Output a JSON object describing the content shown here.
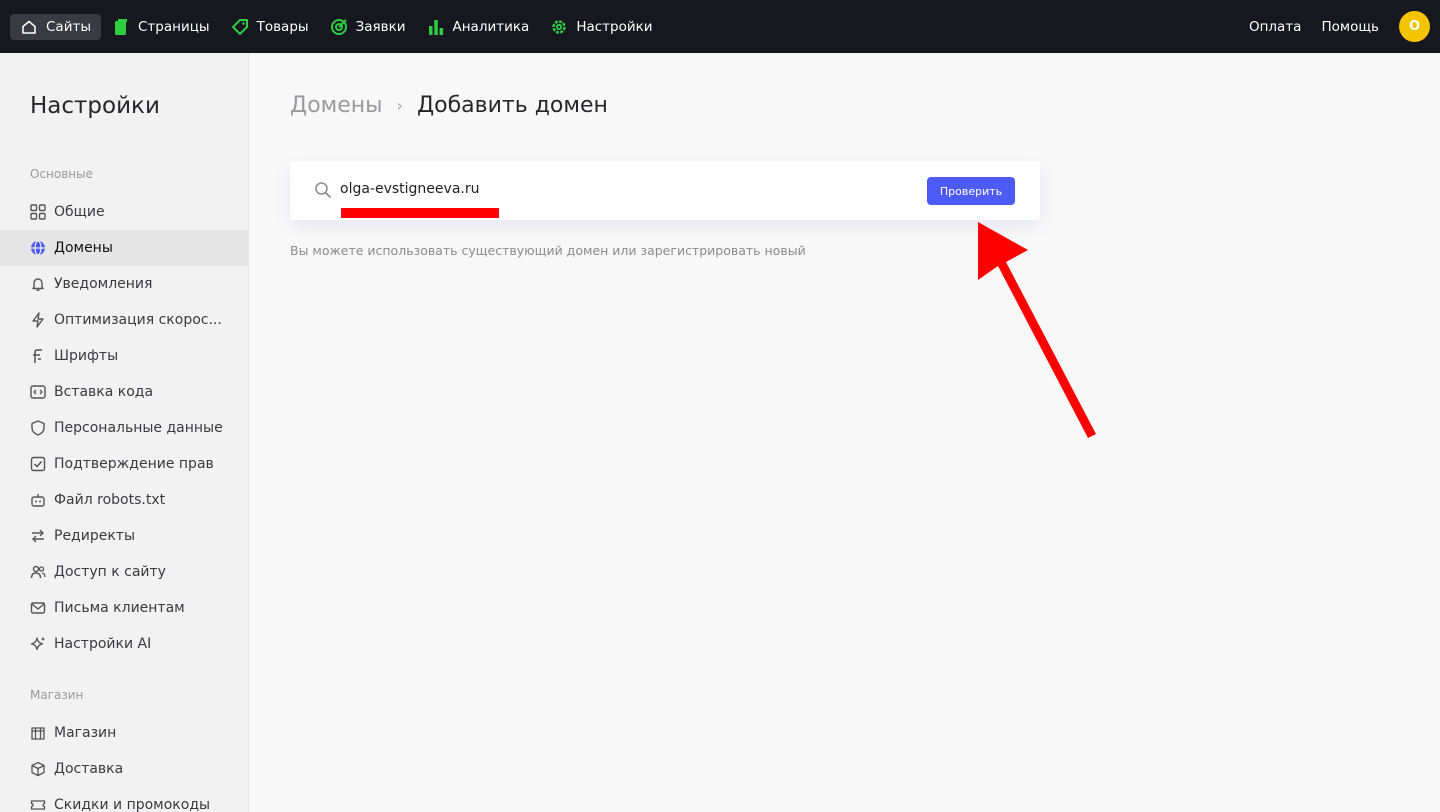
{
  "topbar": {
    "nav": [
      {
        "label": "Сайты",
        "icon": "home-icon",
        "active": true
      },
      {
        "label": "Страницы",
        "icon": "pages-icon"
      },
      {
        "label": "Товары",
        "icon": "tag-icon"
      },
      {
        "label": "Заявки",
        "icon": "target-icon"
      },
      {
        "label": "Аналитика",
        "icon": "bar-chart-icon"
      },
      {
        "label": "Настройки",
        "icon": "gear-icon"
      }
    ],
    "payment": "Оплата",
    "help": "Помощь",
    "avatar_letter": "O",
    "accent_color": "#2ecc40",
    "avatar_color": "#f5c400"
  },
  "sidebar": {
    "title": "Настройки",
    "section_main": "Основные",
    "items": [
      {
        "label": "Общие",
        "icon": "grid-icon"
      },
      {
        "label": "Домены",
        "icon": "globe-icon",
        "active": true
      },
      {
        "label": "Уведомления",
        "icon": "bell-icon"
      },
      {
        "label": "Оптимизация скорос...",
        "icon": "lightning-icon"
      },
      {
        "label": "Шрифты",
        "icon": "font-icon"
      },
      {
        "label": "Вставка кода",
        "icon": "code-icon"
      },
      {
        "label": "Персональные данные",
        "icon": "shield-icon"
      },
      {
        "label": "Подтверждение прав",
        "icon": "checkbox-icon"
      },
      {
        "label": "Файл robots.txt",
        "icon": "robot-icon"
      },
      {
        "label": "Редиректы",
        "icon": "arrows-icon"
      },
      {
        "label": "Доступ к сайту",
        "icon": "users-icon"
      },
      {
        "label": "Письма клиентам",
        "icon": "mail-icon"
      },
      {
        "label": "Настройки AI",
        "icon": "sparkle-icon"
      }
    ],
    "section_shop": "Магазин",
    "shop_items": [
      {
        "label": "Магазин",
        "icon": "store-icon"
      },
      {
        "label": "Доставка",
        "icon": "box-icon"
      },
      {
        "label": "Скидки и промокоды",
        "icon": "ticket-icon"
      }
    ]
  },
  "main": {
    "breadcrumb_parent": "Домены",
    "breadcrumb_current": "Добавить домен",
    "search_value": "olga-evstigneeva.ru",
    "check_button": "Проверить",
    "hint": "Вы можете использовать существующий домен или зарегистрировать новый",
    "button_color": "#4f5bf5",
    "annotation_color": "#ff0000"
  }
}
